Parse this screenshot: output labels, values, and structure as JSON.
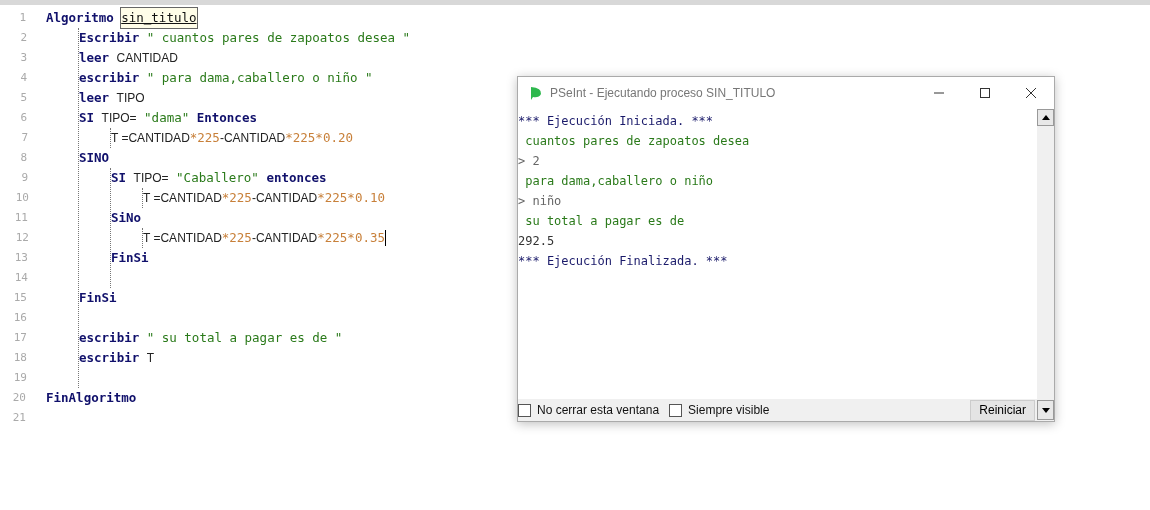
{
  "editor": {
    "lines": [
      {
        "number": "1",
        "tokens": [
          {
            "kind": "keyword",
            "text": "Algoritmo"
          },
          {
            "kind": "match",
            "text": "sin_titulo"
          }
        ],
        "children": [
          {
            "number": "2",
            "tokens": [
              {
                "kind": "keyword",
                "text": "Escribir"
              },
              {
                "kind": "string",
                "text": "\" cuantos pares de zapoatos desea \""
              }
            ]
          },
          {
            "number": "3",
            "tokens": [
              {
                "kind": "keyword",
                "text": "leer"
              },
              {
                "kind": "text",
                "text": "CANTIDAD"
              }
            ]
          },
          {
            "number": "4",
            "tokens": [
              {
                "kind": "keyword",
                "text": "escribir"
              },
              {
                "kind": "string",
                "text": "\" para dama,caballero o niño \""
              }
            ]
          },
          {
            "number": "5",
            "tokens": [
              {
                "kind": "keyword",
                "text": "leer"
              },
              {
                "kind": "text",
                "text": "TIPO"
              }
            ]
          },
          {
            "number": "6",
            "tokens": [
              {
                "kind": "keyword",
                "text": "SI"
              },
              {
                "kind": "text",
                "text": "TIPO="
              },
              {
                "kind": "string",
                "text": "\"dama\""
              },
              {
                "kind": "keyword",
                "text": "Entonces"
              }
            ],
            "children": [
              {
                "number": "7",
                "tokens": [
                  {
                    "kind": "text",
                    "text": "T =CANTIDAD"
                  },
                  {
                    "kind": "number",
                    "text": "*225"
                  },
                  {
                    "kind": "text",
                    "text": "-CANTIDAD"
                  },
                  {
                    "kind": "number",
                    "text": "*225*0.20"
                  }
                ]
              }
            ]
          },
          {
            "number": "8",
            "tokens": [
              {
                "kind": "keyword",
                "text": "SINO"
              }
            ],
            "children": [
              {
                "number": "9",
                "tokens": [
                  {
                    "kind": "keyword",
                    "text": "SI"
                  },
                  {
                    "kind": "text",
                    "text": "TIPO="
                  },
                  {
                    "kind": "string",
                    "text": "\"Caballero\""
                  },
                  {
                    "kind": "keyword",
                    "text": "entonces"
                  }
                ],
                "children": [
                  {
                    "number": "10",
                    "tokens": [
                      {
                        "kind": "text",
                        "text": "T =CANTIDAD"
                      },
                      {
                        "kind": "number",
                        "text": "*225"
                      },
                      {
                        "kind": "text",
                        "text": "-CANTIDAD"
                      },
                      {
                        "kind": "number",
                        "text": "*225*0.10"
                      }
                    ]
                  }
                ]
              },
              {
                "number": "11",
                "tokens": [
                  {
                    "kind": "keyword",
                    "text": "SiNo"
                  }
                ],
                "children": [
                  {
                    "number": "12",
                    "cursor": true,
                    "tokens": [
                      {
                        "kind": "text",
                        "text": "T =CANTIDAD"
                      },
                      {
                        "kind": "number",
                        "text": "*225"
                      },
                      {
                        "kind": "text",
                        "text": "-CANTIDAD"
                      },
                      {
                        "kind": "number",
                        "text": "*225*0.35"
                      }
                    ]
                  }
                ]
              },
              {
                "number": "13",
                "tokens": [
                  {
                    "kind": "keyword",
                    "text": "FinSi"
                  }
                ]
              },
              {
                "number": "14"
              }
            ]
          },
          {
            "number": "15",
            "tokens": [
              {
                "kind": "keyword",
                "text": "FinSi"
              }
            ]
          },
          {
            "number": "16"
          },
          {
            "number": "17",
            "tokens": [
              {
                "kind": "keyword",
                "text": "escribir"
              },
              {
                "kind": "string",
                "text": "\" su total a pagar es de \""
              }
            ]
          },
          {
            "number": "18",
            "tokens": [
              {
                "kind": "keyword",
                "text": "escribir"
              },
              {
                "kind": "text",
                "text": "T"
              }
            ]
          },
          {
            "number": "19"
          }
        ]
      },
      {
        "number": "20",
        "tokens": [
          {
            "kind": "keyword",
            "text": "FinAlgoritmo"
          }
        ]
      },
      {
        "number": "21"
      }
    ]
  },
  "console_window": {
    "title": "PSeInt - Ejecutando proceso SIN_TITULO",
    "lines": [
      {
        "kind": "system",
        "text": "*** Ejecución Iniciada. ***"
      },
      {
        "kind": "output",
        "text": " cuantos pares de zapoatos desea"
      },
      {
        "kind": "input",
        "text": "> 2"
      },
      {
        "kind": "output",
        "text": " para dama,caballero o niño"
      },
      {
        "kind": "input",
        "text": "> niño"
      },
      {
        "kind": "output",
        "text": " su total a pagar es de"
      },
      {
        "kind": "result",
        "text": "292.5"
      },
      {
        "kind": "system",
        "text": "*** Ejecución Finalizada. ***"
      }
    ],
    "options": [
      {
        "label": "No cerrar esta ventana",
        "checked": false
      },
      {
        "label": "Siempre visible",
        "checked": false
      }
    ],
    "button": "Reiniciar"
  }
}
